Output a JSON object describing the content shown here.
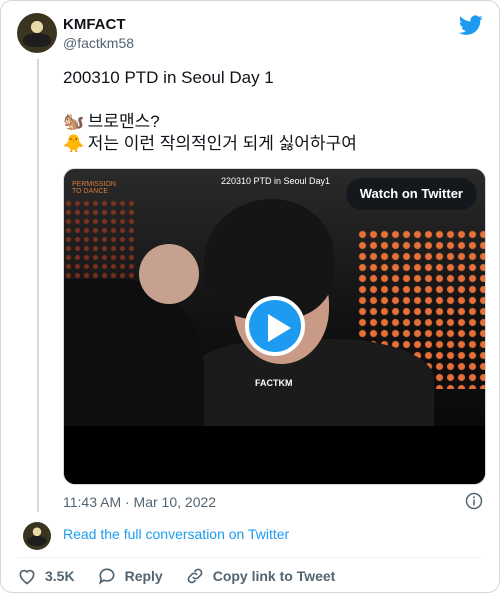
{
  "author": {
    "name": "KMFACT",
    "handle": "@factkm58",
    "avatar_icon": "avatar-icon"
  },
  "tweet": {
    "line1": "200310 PTD in Seoul Day 1",
    "line2_emoji": "🐿️",
    "line2": "브로맨스?",
    "line3_emoji": "🐥",
    "line3": "저는 이런 작의적인거 되게 싫어하구여"
  },
  "media": {
    "overlay_title": "220310 PTD in Seoul  Day1",
    "watch_label": "Watch on Twitter",
    "watermark": "FACTKM",
    "corner_logo": "PERMISSION TO DANCE"
  },
  "meta": {
    "timestamp": "11:43 AM · Mar 10, 2022",
    "read_conversation": "Read the full conversation on Twitter"
  },
  "actions": {
    "likes": "3.5K",
    "reply": "Reply",
    "copy_link": "Copy link to Tweet"
  },
  "colors": {
    "accent": "#1d9bf0",
    "secondary_text": "#536471",
    "border": "#cfd9de"
  }
}
